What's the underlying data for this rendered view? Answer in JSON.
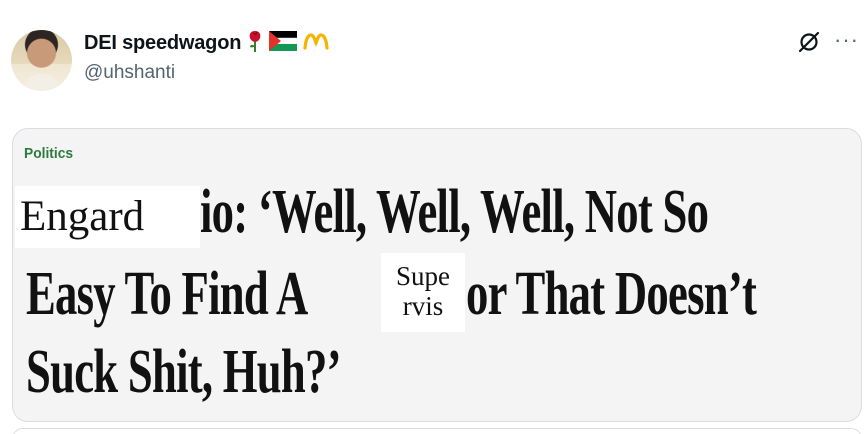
{
  "author": {
    "display_name": "DEI speedwagon",
    "handle": "@uhshanti",
    "emoji_icons": [
      "rose-icon",
      "palestine-flag-icon",
      "crown-icon"
    ]
  },
  "header_actions": {
    "grok_icon": "grok-icon",
    "more_label": "···"
  },
  "card": {
    "section": "Politics",
    "headline_line1": "io: ‘Well, Well, Well, Not So",
    "headline_line2a": "Easy To Find A",
    "headline_line2b": "or That Doesn’t",
    "headline_line3": "Suck Shit, Huh?’",
    "patch_word": "Engard",
    "patch_super_top": "Supe",
    "patch_super_bottom": "rvis"
  },
  "colors": {
    "section_green": "#2e7a3c",
    "handle_gray": "#536471",
    "card_bg": "#f4f4f4"
  }
}
